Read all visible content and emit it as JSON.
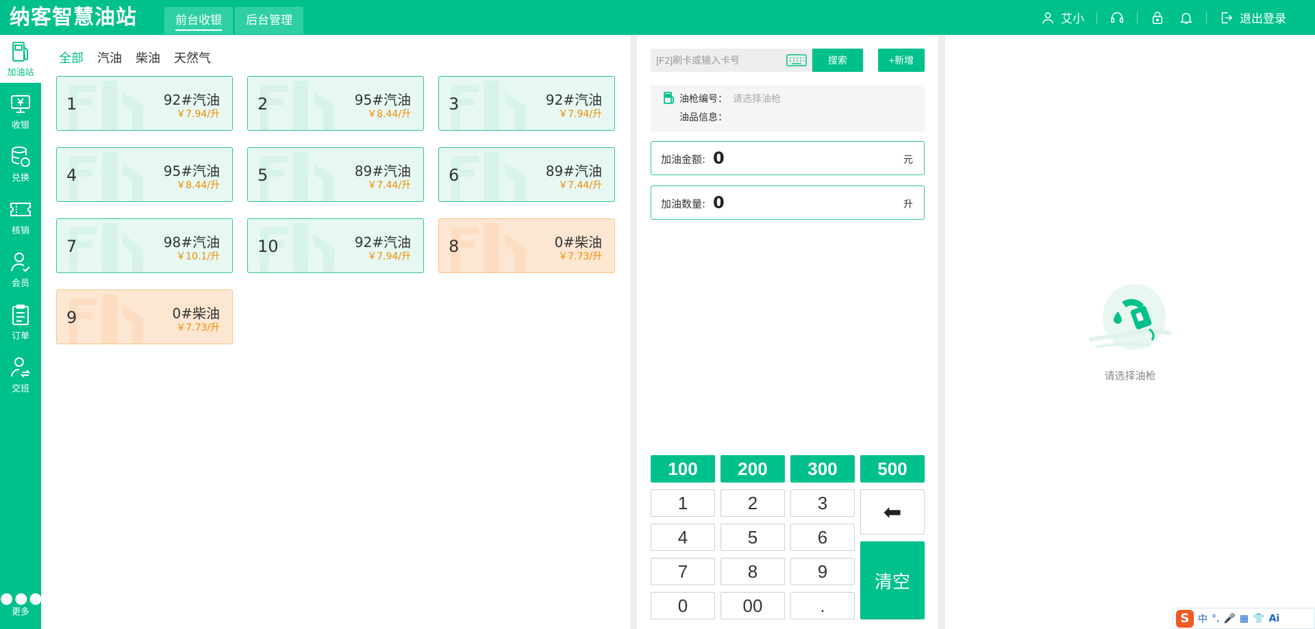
{
  "app": {
    "logo": "纳客智慧油站",
    "nav_tabs": [
      {
        "label": "前台收银",
        "active": true
      },
      {
        "label": "后台管理",
        "active": false
      }
    ],
    "user_name": "艾小",
    "logout": "退出登录"
  },
  "sidebar": {
    "items": [
      {
        "label": "加油站",
        "icon": "fuel-pump-icon",
        "active": true
      },
      {
        "label": "收银",
        "icon": "cashier-icon"
      },
      {
        "label": "兑换",
        "icon": "exchange-icon"
      },
      {
        "label": "核销",
        "icon": "ticket-icon"
      },
      {
        "label": "会员",
        "icon": "member-icon"
      },
      {
        "label": "订单",
        "icon": "order-icon"
      },
      {
        "label": "交班",
        "icon": "shift-icon"
      }
    ],
    "more": "更多"
  },
  "filters": [
    "全部",
    "汽油",
    "柴油",
    "天然气"
  ],
  "guns": [
    {
      "num": "1",
      "fuel": "92#汽油",
      "price": "￥7.94/升",
      "kind": "gas"
    },
    {
      "num": "2",
      "fuel": "95#汽油",
      "price": "￥8.44/升",
      "kind": "gas"
    },
    {
      "num": "3",
      "fuel": "92#汽油",
      "price": "￥7.94/升",
      "kind": "gas"
    },
    {
      "num": "4",
      "fuel": "95#汽油",
      "price": "￥8.44/升",
      "kind": "gas"
    },
    {
      "num": "5",
      "fuel": "89#汽油",
      "price": "￥7.44/升",
      "kind": "gas"
    },
    {
      "num": "6",
      "fuel": "89#汽油",
      "price": "￥7.44/升",
      "kind": "gas"
    },
    {
      "num": "7",
      "fuel": "98#汽油",
      "price": "￥10.1/升",
      "kind": "gas"
    },
    {
      "num": "10",
      "fuel": "92#汽油",
      "price": "￥7.94/升",
      "kind": "gas"
    },
    {
      "num": "8",
      "fuel": "0#柴油",
      "price": "￥7.73/升",
      "kind": "diesel"
    },
    {
      "num": "9",
      "fuel": "0#柴油",
      "price": "￥7.73/升",
      "kind": "diesel"
    }
  ],
  "search": {
    "placeholder": "[F2]刷卡或输入卡号",
    "button": "搜索",
    "add": "+新增"
  },
  "gun_info": {
    "gun_label": "油枪编号：",
    "gun_placeholder": "请选择油枪",
    "oil_label": "油品信息："
  },
  "amount": {
    "label": "加油金额:",
    "value": "0",
    "unit": "元"
  },
  "quantity": {
    "label": "加油数量:",
    "value": "0",
    "unit": "升"
  },
  "quick_amounts": [
    "100",
    "200",
    "300",
    "500"
  ],
  "keys": [
    "1",
    "2",
    "3",
    "4",
    "5",
    "6",
    "7",
    "8",
    "9",
    "0",
    "00",
    "."
  ],
  "backspace": "⬅",
  "clear": "清空",
  "empty_text": "请选择油枪",
  "ime": {
    "logo": "S",
    "mode": "中",
    "punct": "°,",
    "ai": "Ai"
  },
  "colors": {
    "primary": "#00c08b",
    "price": "#f08b00",
    "diesel_bg": "#fde7d2"
  }
}
